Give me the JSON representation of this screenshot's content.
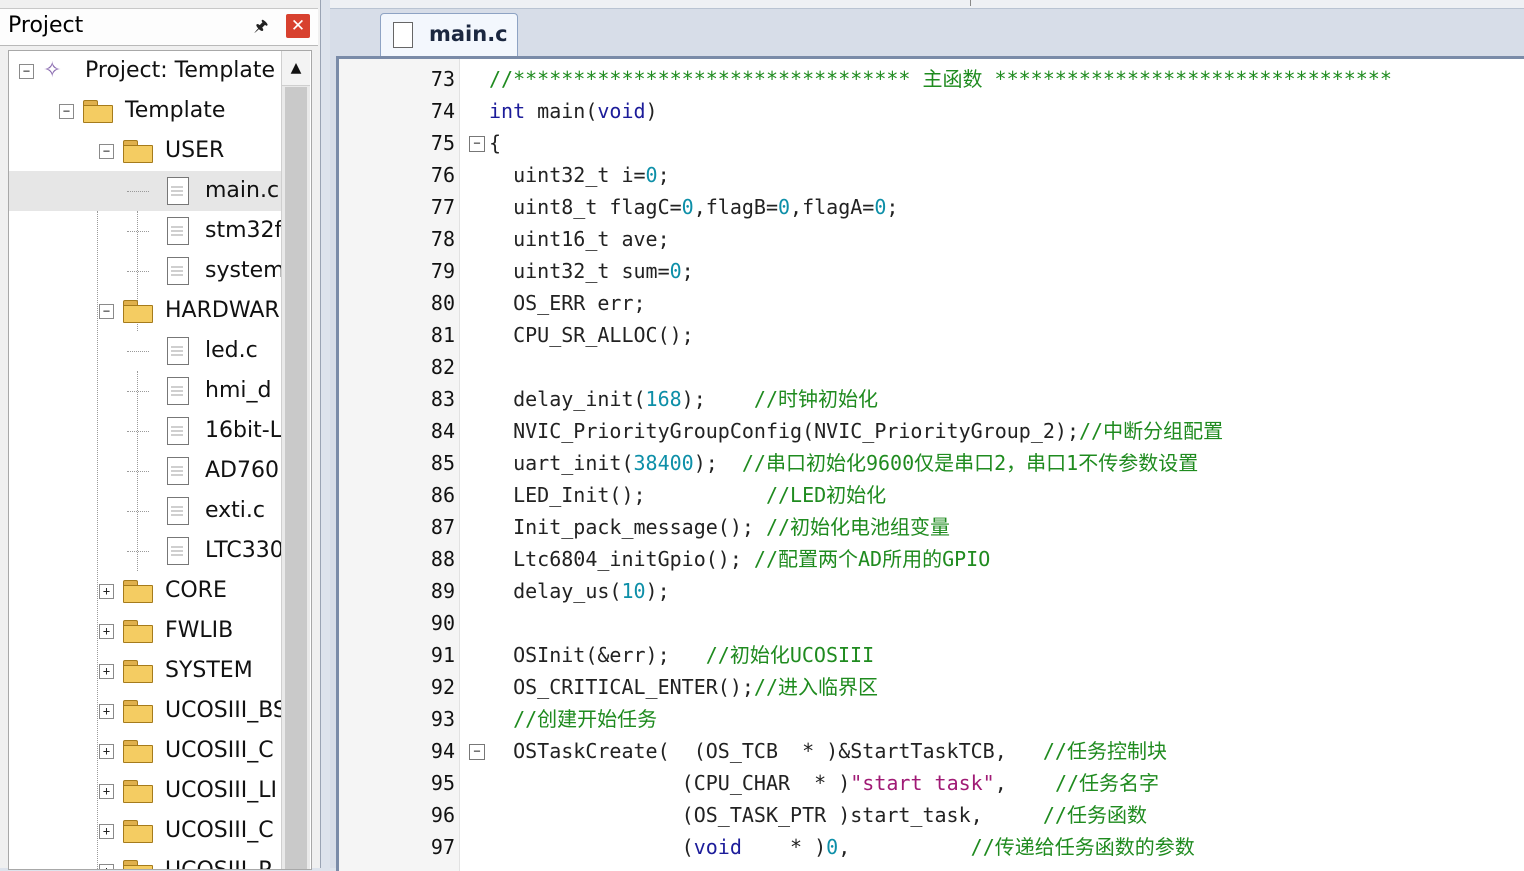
{
  "project_panel": {
    "title": "Project",
    "tree": [
      {
        "label": "Project: Template",
        "icon": "project-icon",
        "expander": "−"
      },
      {
        "label": "Template",
        "icon": "target-folder-icon",
        "expander": "−"
      },
      {
        "label": "USER",
        "icon": "folder-open-icon",
        "expander": "−"
      },
      {
        "label": "main.c",
        "icon": "file-icon"
      },
      {
        "label": "stm32f",
        "icon": "file-icon"
      },
      {
        "label": "system",
        "icon": "file-icon"
      },
      {
        "label": "HARDWAR",
        "icon": "folder-open-icon",
        "expander": "−"
      },
      {
        "label": "led.c",
        "icon": "file-icon"
      },
      {
        "label": "hmi_d",
        "icon": "file-icon"
      },
      {
        "label": "16bit-L",
        "icon": "file-icon"
      },
      {
        "label": "AD760",
        "icon": "file-icon"
      },
      {
        "label": "exti.c",
        "icon": "file-icon"
      },
      {
        "label": "LTC330",
        "icon": "file-icon"
      },
      {
        "label": "CORE",
        "icon": "folder-icon",
        "expander": "+"
      },
      {
        "label": "FWLIB",
        "icon": "folder-icon",
        "expander": "+"
      },
      {
        "label": "SYSTEM",
        "icon": "folder-icon",
        "expander": "+"
      },
      {
        "label": "UCOSIII_BS",
        "icon": "folder-icon",
        "expander": "+"
      },
      {
        "label": "UCOSIII_C",
        "icon": "folder-icon",
        "expander": "+"
      },
      {
        "label": "UCOSIII_LI",
        "icon": "folder-icon",
        "expander": "+"
      },
      {
        "label": "UCOSIII_C",
        "icon": "folder-icon",
        "expander": "+"
      },
      {
        "label": "UCOSIII_P",
        "icon": "folder-icon",
        "expander": "+"
      }
    ]
  },
  "editor": {
    "tab_label": "main.c",
    "lines": [
      {
        "n": "73",
        "segs": [
          {
            "t": "//********************************* ",
            "c": "cm"
          },
          {
            "t": "主函数 ",
            "c": "cm"
          },
          {
            "t": "*********************************",
            "c": "cm"
          }
        ]
      },
      {
        "n": "74",
        "segs": [
          {
            "t": "int",
            "c": "kw"
          },
          {
            "t": " main(",
            "c": ""
          },
          {
            "t": "void",
            "c": "kw"
          },
          {
            "t": ")",
            "c": ""
          }
        ]
      },
      {
        "n": "75",
        "fold": true,
        "segs": [
          {
            "t": "{",
            "c": ""
          }
        ]
      },
      {
        "n": "76",
        "segs": [
          {
            "t": "  uint32_t i=",
            "c": ""
          },
          {
            "t": "0",
            "c": "num"
          },
          {
            "t": ";",
            "c": ""
          }
        ]
      },
      {
        "n": "77",
        "segs": [
          {
            "t": "  uint8_t flagC=",
            "c": ""
          },
          {
            "t": "0",
            "c": "num"
          },
          {
            "t": ",flagB=",
            "c": ""
          },
          {
            "t": "0",
            "c": "num"
          },
          {
            "t": ",flagA=",
            "c": ""
          },
          {
            "t": "0",
            "c": "num"
          },
          {
            "t": ";",
            "c": ""
          }
        ]
      },
      {
        "n": "78",
        "segs": [
          {
            "t": "  uint16_t ave;",
            "c": ""
          }
        ]
      },
      {
        "n": "79",
        "segs": [
          {
            "t": "  uint32_t sum=",
            "c": ""
          },
          {
            "t": "0",
            "c": "num"
          },
          {
            "t": ";",
            "c": ""
          }
        ]
      },
      {
        "n": "80",
        "segs": [
          {
            "t": "  OS_ERR err;",
            "c": ""
          }
        ]
      },
      {
        "n": "81",
        "segs": [
          {
            "t": "  CPU_SR_ALLOC();",
            "c": ""
          }
        ]
      },
      {
        "n": "82",
        "segs": [
          {
            "t": "",
            "c": ""
          }
        ]
      },
      {
        "n": "83",
        "segs": [
          {
            "t": "  delay_init(",
            "c": ""
          },
          {
            "t": "168",
            "c": "num"
          },
          {
            "t": ");    ",
            "c": ""
          },
          {
            "t": "//时钟初始化",
            "c": "cm"
          }
        ]
      },
      {
        "n": "84",
        "segs": [
          {
            "t": "  NVIC_PriorityGroupConfig(NVIC_PriorityGroup_2);",
            "c": ""
          },
          {
            "t": "//中断分组配置",
            "c": "cm"
          }
        ]
      },
      {
        "n": "85",
        "segs": [
          {
            "t": "  uart_init(",
            "c": ""
          },
          {
            "t": "38400",
            "c": "num"
          },
          {
            "t": ");  ",
            "c": ""
          },
          {
            "t": "//串口初始化9600仅是串口2，串口1不传参数设置",
            "c": "cm"
          }
        ]
      },
      {
        "n": "86",
        "segs": [
          {
            "t": "  LED_Init();          ",
            "c": ""
          },
          {
            "t": "//LED初始化",
            "c": "cm"
          }
        ]
      },
      {
        "n": "87",
        "segs": [
          {
            "t": "  Init_pack_message(); ",
            "c": ""
          },
          {
            "t": "//初始化电池组变量",
            "c": "cm"
          }
        ]
      },
      {
        "n": "88",
        "segs": [
          {
            "t": "  Ltc6804_initGpio(); ",
            "c": ""
          },
          {
            "t": "//配置两个AD所用的GPIO",
            "c": "cm"
          }
        ]
      },
      {
        "n": "89",
        "segs": [
          {
            "t": "  delay_us(",
            "c": ""
          },
          {
            "t": "10",
            "c": "num"
          },
          {
            "t": ");",
            "c": ""
          }
        ]
      },
      {
        "n": "90",
        "segs": [
          {
            "t": "",
            "c": ""
          }
        ]
      },
      {
        "n": "91",
        "segs": [
          {
            "t": "  OSInit(&err);   ",
            "c": ""
          },
          {
            "t": "//初始化UCOSIII",
            "c": "cm"
          }
        ]
      },
      {
        "n": "92",
        "segs": [
          {
            "t": "  OS_CRITICAL_ENTER();",
            "c": ""
          },
          {
            "t": "//进入临界区",
            "c": "cm"
          }
        ]
      },
      {
        "n": "93",
        "segs": [
          {
            "t": "  ",
            "c": ""
          },
          {
            "t": "//创建开始任务",
            "c": "cm"
          }
        ]
      },
      {
        "n": "94",
        "fold": true,
        "segs": [
          {
            "t": "  OSTaskCreate(  (OS_TCB  * )&StartTaskTCB,   ",
            "c": ""
          },
          {
            "t": "//任务控制块",
            "c": "cm"
          }
        ]
      },
      {
        "n": "95",
        "segs": [
          {
            "t": "                (CPU_CHAR  * )",
            "c": ""
          },
          {
            "t": "\"start task\"",
            "c": "str"
          },
          {
            "t": ",    ",
            "c": ""
          },
          {
            "t": "//任务名字",
            "c": "cm"
          }
        ]
      },
      {
        "n": "96",
        "segs": [
          {
            "t": "                (OS_TASK_PTR )start_task,     ",
            "c": ""
          },
          {
            "t": "//任务函数",
            "c": "cm"
          }
        ]
      },
      {
        "n": "97",
        "segs": [
          {
            "t": "                (",
            "c": ""
          },
          {
            "t": "void",
            "c": "kw"
          },
          {
            "t": "    * )",
            "c": ""
          },
          {
            "t": "0",
            "c": "num"
          },
          {
            "t": ",          ",
            "c": ""
          },
          {
            "t": "//传递给任务函数的参数",
            "c": "cm"
          }
        ]
      }
    ]
  }
}
